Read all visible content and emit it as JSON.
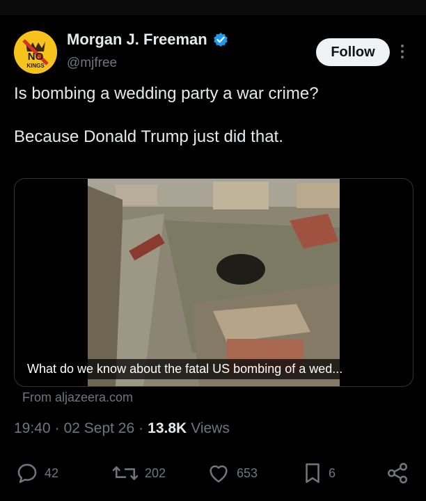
{
  "author": {
    "name": "Morgan J. Freeman",
    "handle": "@mjfree",
    "avatar_text_top": "NO",
    "avatar_text_bottom": "KINGS"
  },
  "follow_label": "Follow",
  "tweet": {
    "paragraphs": [
      "Is bombing a wedding party a war crime?",
      "Because Donald Trump just did that."
    ]
  },
  "card": {
    "caption": "What do we know about the fatal US bombing of a wed...",
    "source": "From aljazeera.com"
  },
  "meta": {
    "time": "19:40",
    "date": "02 Sept 26",
    "views_count": "13.8K",
    "views_label": "Views",
    "separator": "·"
  },
  "actions": {
    "replies": "42",
    "reposts": "202",
    "likes": "653",
    "bookmarks": "6"
  },
  "colors": {
    "background": "#000000",
    "text": "#e7e9ea",
    "muted": "#71767b",
    "verified": "#1d9bf0",
    "avatar": "#f6c21c"
  }
}
